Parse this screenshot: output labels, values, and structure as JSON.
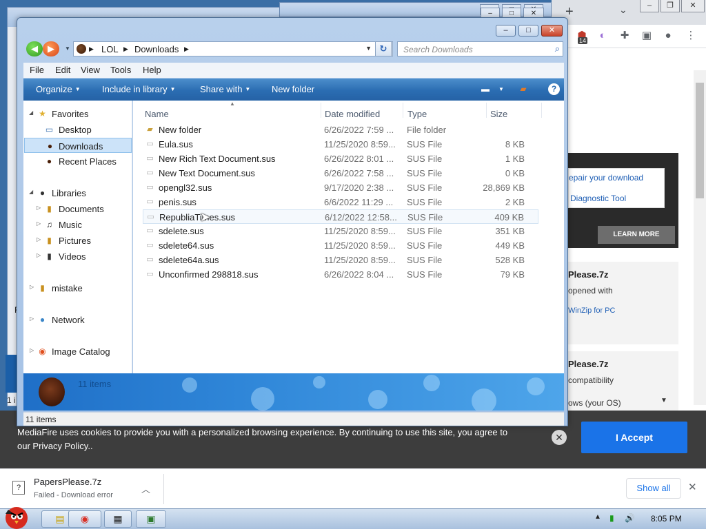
{
  "explorer": {
    "address": {
      "segments": [
        "LOL",
        "Downloads"
      ]
    },
    "search_placeholder": "Search Downloads",
    "menu": [
      "File",
      "Edit",
      "View",
      "Tools",
      "Help"
    ],
    "commands": {
      "organize": "Organize",
      "include": "Include in library",
      "share": "Share with",
      "new_folder": "New folder"
    },
    "nav": {
      "favorites": "Favorites",
      "desktop": "Desktop",
      "downloads": "Downloads",
      "recent": "Recent Places",
      "libraries": "Libraries",
      "documents": "Documents",
      "music": "Music",
      "pictures": "Pictures",
      "videos": "Videos",
      "mistake": "mistake",
      "network": "Network",
      "image_catalog": "Image Catalog"
    },
    "columns": {
      "name": "Name",
      "date": "Date modified",
      "type": "Type",
      "size": "Size"
    },
    "files": [
      {
        "name": "New folder",
        "date": "6/26/2022 7:59 ...",
        "type": "File folder",
        "size": ""
      },
      {
        "name": "Eula.sus",
        "date": "11/25/2020 8:59...",
        "type": "SUS File",
        "size": "8 KB"
      },
      {
        "name": "New Rich Text Document.sus",
        "date": "6/26/2022 8:01 ...",
        "type": "SUS File",
        "size": "1 KB"
      },
      {
        "name": "New Text Document.sus",
        "date": "6/26/2022 7:58 ...",
        "type": "SUS File",
        "size": "0 KB"
      },
      {
        "name": "opengl32.sus",
        "date": "9/17/2020 2:38 ...",
        "type": "SUS File",
        "size": "28,869 KB"
      },
      {
        "name": "penis.sus",
        "date": "6/6/2022 11:29 ...",
        "type": "SUS File",
        "size": "2 KB"
      },
      {
        "name": "RepubliaTimes.sus",
        "date": "6/12/2022 12:58...",
        "type": "SUS File",
        "size": "409 KB"
      },
      {
        "name": "sdelete.sus",
        "date": "11/25/2020 8:59...",
        "type": "SUS File",
        "size": "351 KB"
      },
      {
        "name": "sdelete64.sus",
        "date": "11/25/2020 8:59...",
        "type": "SUS File",
        "size": "449 KB"
      },
      {
        "name": "sdelete64a.sus",
        "date": "11/25/2020 8:59...",
        "type": "SUS File",
        "size": "528 KB"
      },
      {
        "name": "Unconfirmed 298818.sus",
        "date": "6/26/2022 8:04 ...",
        "type": "SUS File",
        "size": "79 KB"
      }
    ],
    "details_count": "11 items",
    "status_count": "11 items"
  },
  "browser": {
    "ext_badge": "14",
    "repair_link": "epair your download",
    "diag_link": "Diagnostic Tool",
    "learn_more": "LEARN MORE",
    "card1_title": "Please.7z",
    "card1_text": "opened with",
    "card1_link": "WinZip for PC",
    "card2_title": "Please.7z",
    "card2_text": "compatibility",
    "card2_select": "ows (your OS)"
  },
  "cookie": {
    "text": "MediaFire uses cookies to provide you with a personalized browsing experience. By continuing to use this site, you agree to our Privacy Policy..",
    "accept": "I Accept"
  },
  "download": {
    "file": "PapersPlease.7z",
    "status": "Failed - Download error",
    "show_all": "Show all"
  },
  "taskbar": {
    "time": "8:05 PM"
  },
  "bg_left": {
    "letter_r": "R",
    "letter_1": "1 i"
  }
}
